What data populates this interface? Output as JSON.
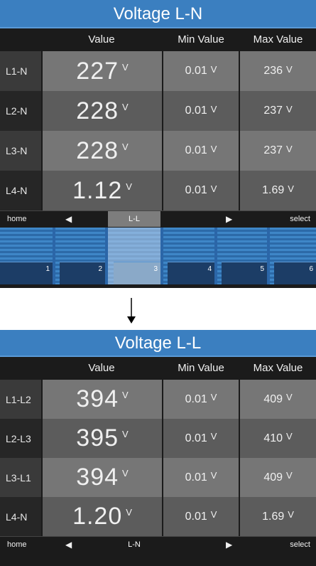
{
  "screen1": {
    "title": "Voltage L-N",
    "headers": [
      "Value",
      "Min Value",
      "Max Value"
    ],
    "rows": [
      {
        "label": "L1-N",
        "value": "227",
        "min": "0.01",
        "max": "236"
      },
      {
        "label": "L2-N",
        "value": "228",
        "min": "0.01",
        "max": "237"
      },
      {
        "label": "L3-N",
        "value": "228",
        "min": "0.01",
        "max": "237"
      },
      {
        "label": "L4-N",
        "value": "1.12",
        "min": "0.01",
        "max": "1.69"
      }
    ],
    "unit": "V",
    "nav": {
      "home": "home",
      "left_arrow": "◀",
      "center": "L-L",
      "right_arrow": "▶",
      "select": "select"
    },
    "tabs": [
      "1",
      "2",
      "3",
      "4",
      "5",
      "6"
    ],
    "active_tab": "3"
  },
  "screen2": {
    "title": "Voltage L-L",
    "headers": [
      "Value",
      "Min Value",
      "Max Value"
    ],
    "rows": [
      {
        "label": "L1-L2",
        "value": "394",
        "min": "0.01",
        "max": "409"
      },
      {
        "label": "L2-L3",
        "value": "395",
        "min": "0.01",
        "max": "410"
      },
      {
        "label": "L3-L1",
        "value": "394",
        "min": "0.01",
        "max": "409"
      },
      {
        "label": "L4-N",
        "value": "1.20",
        "min": "0.01",
        "max": "1.69"
      }
    ],
    "unit": "V",
    "nav": {
      "home": "home",
      "left_arrow": "◀",
      "center": "L-N",
      "right_arrow": "▶",
      "select": "select"
    }
  },
  "transition_arrow_icon": "arrow-down-icon",
  "colors": {
    "title_blue": "#3b7fc0",
    "row_light": "#767676",
    "row_dark": "#5c5c5c",
    "tab_blue": "#3e86c7",
    "background": "#1b1b1b"
  }
}
